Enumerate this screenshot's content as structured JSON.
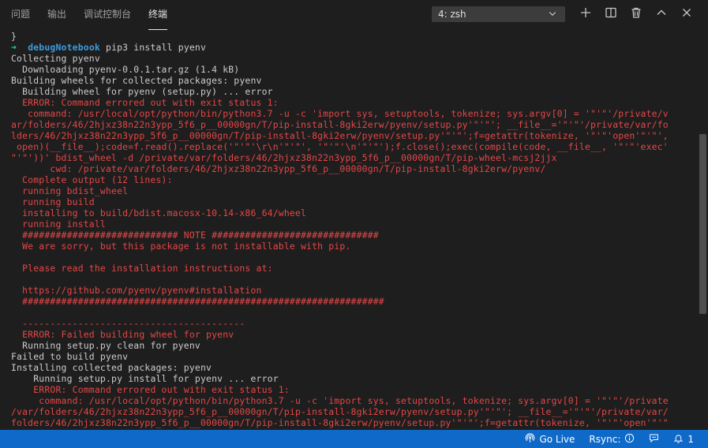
{
  "panel": {
    "tabs": [
      {
        "label": "问题",
        "active": false
      },
      {
        "label": "输出",
        "active": false
      },
      {
        "label": "调试控制台",
        "active": false
      },
      {
        "label": "终端",
        "active": true
      }
    ],
    "terminal_select": {
      "value": "4: zsh",
      "icon": "chevron-down-icon"
    },
    "actions": [
      {
        "name": "new-terminal-button",
        "icon": "plus-icon"
      },
      {
        "name": "split-terminal-button",
        "icon": "split-icon"
      },
      {
        "name": "kill-terminal-button",
        "icon": "trash-icon"
      },
      {
        "name": "maximize-panel-button",
        "icon": "chevron-up-icon"
      },
      {
        "name": "close-panel-button",
        "icon": "close-icon"
      }
    ]
  },
  "terminal": {
    "lines": [
      {
        "c": "white",
        "t": "}"
      },
      {
        "prompt": true,
        "arrow": "➜",
        "dir": "debugNotebook",
        "t": " pip3 install pyenv"
      },
      {
        "c": "white",
        "t": "Collecting pyenv"
      },
      {
        "c": "white",
        "t": "  Downloading pyenv-0.0.1.tar.gz (1.4 kB)"
      },
      {
        "c": "white",
        "t": "Building wheels for collected packages: pyenv"
      },
      {
        "c": "white",
        "t": "  Building wheel for pyenv (setup.py) ... error"
      },
      {
        "c": "red",
        "t": "  ERROR: Command errored out with exit status 1:"
      },
      {
        "c": "red",
        "t": "   command: /usr/local/opt/python/bin/python3.7 -u -c 'import sys, setuptools, tokenize; sys.argv[0] = '\"'\"'/private/v"
      },
      {
        "c": "red",
        "t": "ar/folders/46/2hjxz38n22n3ypp_5f6_p__00000gn/T/pip-install-8gki2erw/pyenv/setup.py'\"'\"'; __file__='\"'\"'/private/var/fo"
      },
      {
        "c": "red",
        "t": "lders/46/2hjxz38n22n3ypp_5f6_p__00000gn/T/pip-install-8gki2erw/pyenv/setup.py'\"'\"';f=getattr(tokenize, '\"'\"'open'\"'\"',"
      },
      {
        "c": "red",
        "t": " open)(__file__);code=f.read().replace('\"'\"'\\r\\n'\"'\"', '\"'\"'\\n'\"'\"');f.close();exec(compile(code, __file__, '\"'\"'exec'"
      },
      {
        "c": "red",
        "t": "\"'\"'))' bdist_wheel -d /private/var/folders/46/2hjxz38n22n3ypp_5f6_p__00000gn/T/pip-wheel-mcsj2jjx"
      },
      {
        "c": "red",
        "t": "       cwd: /private/var/folders/46/2hjxz38n22n3ypp_5f6_p__00000gn/T/pip-install-8gki2erw/pyenv/"
      },
      {
        "c": "red",
        "t": "  Complete output (12 lines):"
      },
      {
        "c": "red",
        "t": "  running bdist_wheel"
      },
      {
        "c": "red",
        "t": "  running build"
      },
      {
        "c": "red",
        "t": "  installing to build/bdist.macosx-10.14-x86_64/wheel"
      },
      {
        "c": "red",
        "t": "  running install"
      },
      {
        "c": "red",
        "t": "  ############################ NOTE ##############################"
      },
      {
        "c": "red",
        "t": "  We are sorry, but this package is not installable with pip."
      },
      {
        "c": "red",
        "t": ""
      },
      {
        "c": "red",
        "t": "  Please read the installation instructions at:"
      },
      {
        "c": "red",
        "t": ""
      },
      {
        "c": "red",
        "t": "  https://github.com/pyenv/pyenv#installation"
      },
      {
        "c": "red",
        "t": "  #################################################################"
      },
      {
        "c": "red",
        "t": ""
      },
      {
        "c": "red",
        "t": "  ----------------------------------------"
      },
      {
        "c": "red",
        "t": "  ERROR: Failed building wheel for pyenv"
      },
      {
        "c": "white",
        "t": "  Running setup.py clean for pyenv"
      },
      {
        "c": "white",
        "t": "Failed to build pyenv"
      },
      {
        "c": "white",
        "t": "Installing collected packages: pyenv"
      },
      {
        "c": "white",
        "t": "    Running setup.py install for pyenv ... error"
      },
      {
        "c": "red",
        "t": "    ERROR: Command errored out with exit status 1:"
      },
      {
        "c": "red",
        "t": "     command: /usr/local/opt/python/bin/python3.7 -u -c 'import sys, setuptools, tokenize; sys.argv[0] = '\"'\"'/private"
      },
      {
        "c": "red",
        "t": "/var/folders/46/2hjxz38n22n3ypp_5f6_p__00000gn/T/pip-install-8gki2erw/pyenv/setup.py'\"'\"'; __file__='\"'\"'/private/var/"
      },
      {
        "c": "red",
        "t": "folders/46/2hjxz38n22n3ypp_5f6_p__00000gn/T/pip-install-8gki2erw/pyenv/setup.py'\"'\"';f=getattr(tokenize, '\"'\"'open'\"'\""
      }
    ]
  },
  "statusbar": {
    "go_live": {
      "label": "Go Live",
      "icon": "broadcast-icon"
    },
    "rsync": {
      "label": "Rsync:",
      "icon": "info-icon"
    },
    "feedback": {
      "icon": "feedback-icon"
    },
    "notifications": {
      "count": "1",
      "icon": "bell-icon"
    }
  },
  "colors": {
    "background": "#1e1e1e",
    "error_text": "#e64646",
    "prompt_arrow": "#23d18b",
    "prompt_dir": "#3b9bdc",
    "statusbar": "#0e69c8"
  }
}
